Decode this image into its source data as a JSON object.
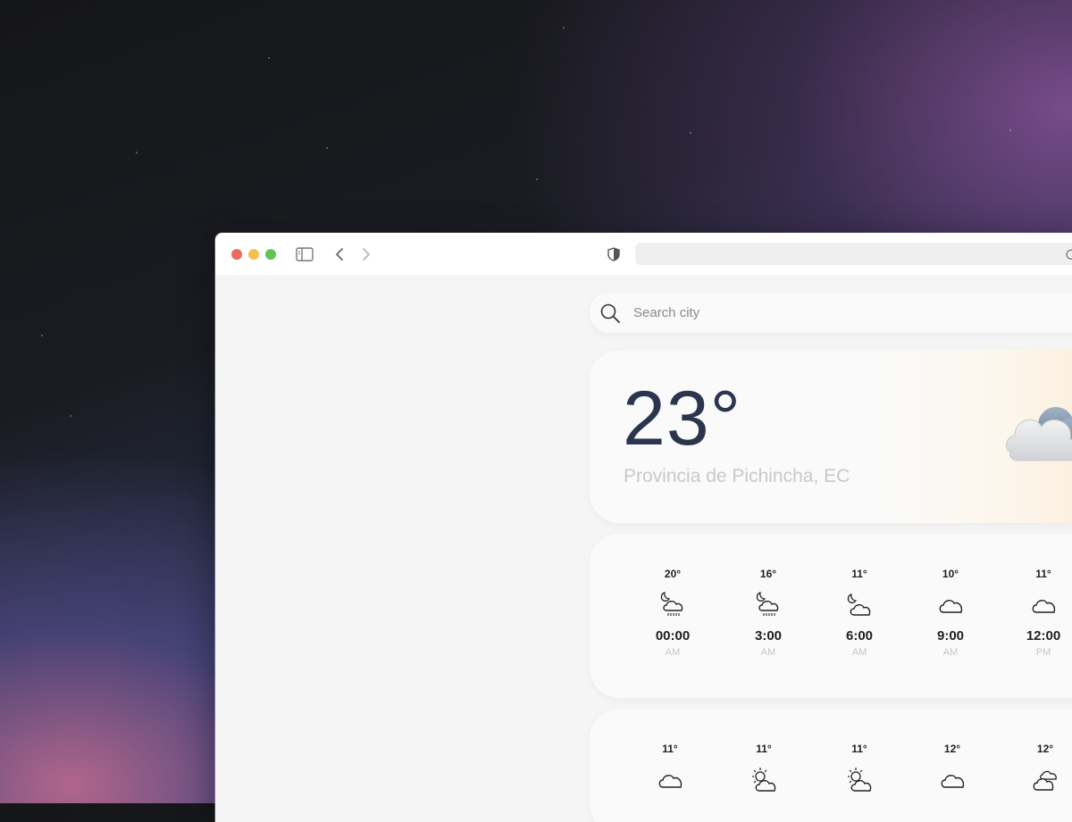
{
  "search": {
    "placeholder": "Search city"
  },
  "current": {
    "temperature": "23°",
    "location": "Provincia de Pichincha, EC",
    "icon": "cloud-icon"
  },
  "hourly_forecast": [
    {
      "temp": "20°",
      "icon": "night-rain-icon",
      "time": "00:00",
      "period": "AM"
    },
    {
      "temp": "16°",
      "icon": "night-rain-icon",
      "time": "3:00",
      "period": "AM"
    },
    {
      "temp": "11°",
      "icon": "night-cloud-icon",
      "time": "6:00",
      "period": "AM"
    },
    {
      "temp": "10°",
      "icon": "cloud-icon",
      "time": "9:00",
      "period": "AM"
    },
    {
      "temp": "11°",
      "icon": "cloud-icon",
      "time": "12:00",
      "period": "PM"
    }
  ],
  "next_forecast": [
    {
      "temp": "11°",
      "icon": "cloud-icon"
    },
    {
      "temp": "11°",
      "icon": "partly-sunny-icon"
    },
    {
      "temp": "11°",
      "icon": "partly-sunny-icon"
    },
    {
      "temp": "12°",
      "icon": "cloud-icon"
    },
    {
      "temp": "12°",
      "icon": "cloudy-icon"
    }
  ]
}
